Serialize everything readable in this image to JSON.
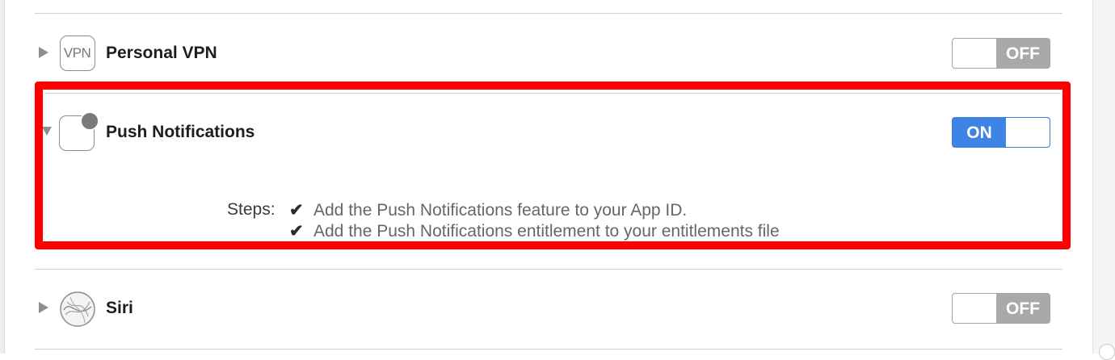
{
  "capabilities": {
    "vpn": {
      "title": "Personal VPN",
      "icon_text": "VPN",
      "icon": "vpn-icon",
      "toggle_label": "OFF",
      "enabled": false,
      "expanded": false
    },
    "push": {
      "title": "Push Notifications",
      "icon": "push-notifications-icon",
      "toggle_label": "ON",
      "enabled": true,
      "expanded": true,
      "steps_label": "Steps:",
      "steps": [
        {
          "check": "✔",
          "text": "Add the Push Notifications feature to your App ID."
        },
        {
          "check": "✔",
          "text": "Add the Push Notifications entitlement to your entitlements file"
        }
      ]
    },
    "siri": {
      "title": "Siri",
      "icon": "siri-icon",
      "toggle_label": "OFF",
      "enabled": false,
      "expanded": false
    }
  },
  "colors": {
    "toggle_on": "#3d84e5",
    "toggle_off": "#a9a9a9",
    "highlight": "#ff0000"
  }
}
